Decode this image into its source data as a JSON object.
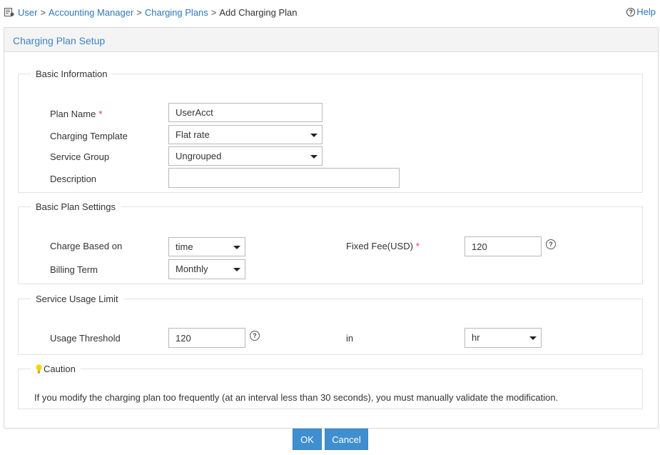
{
  "breadcrumb": {
    "items": [
      "User",
      "Accounting Manager",
      "Charging Plans"
    ],
    "separator": ">",
    "current": "Add Charging Plan"
  },
  "help": {
    "label": "Help"
  },
  "panel": {
    "title": "Charging Plan Setup"
  },
  "basic_info": {
    "legend": "Basic Information",
    "plan_name": {
      "label": "Plan Name",
      "required": "*",
      "value": "UserAcct"
    },
    "charging_template": {
      "label": "Charging Template",
      "value": "Flat rate"
    },
    "service_group": {
      "label": "Service Group",
      "value": "Ungrouped"
    },
    "description": {
      "label": "Description",
      "value": ""
    }
  },
  "plan_settings": {
    "legend": "Basic Plan Settings",
    "charge_based_on": {
      "label": "Charge Based on",
      "value": "time"
    },
    "billing_term": {
      "label": "Billing Term",
      "value": "Monthly"
    },
    "fixed_fee": {
      "label": "Fixed Fee(USD)",
      "required": "*",
      "value": "120"
    }
  },
  "usage_limit": {
    "legend": "Service Usage Limit",
    "threshold": {
      "label": "Usage Threshold",
      "value": "120"
    },
    "in_label": "in",
    "unit": {
      "value": "hr"
    }
  },
  "caution": {
    "legend": "Caution",
    "text": "If you modify the charging plan too frequently (at an interval less than 30 seconds), you must manually validate the modification."
  },
  "buttons": {
    "ok": "OK",
    "cancel": "Cancel"
  },
  "colors": {
    "link": "#2f76b8",
    "title": "#3d84c6",
    "button": "#3f8fd0",
    "required": "#e0333a"
  },
  "icons": {
    "breadcrumb": "user-accounting-icon",
    "help": "help-question-icon",
    "tip": "question-tip-icon",
    "caution": "lightbulb-icon",
    "dropdown": "dropdown-arrow-icon"
  }
}
